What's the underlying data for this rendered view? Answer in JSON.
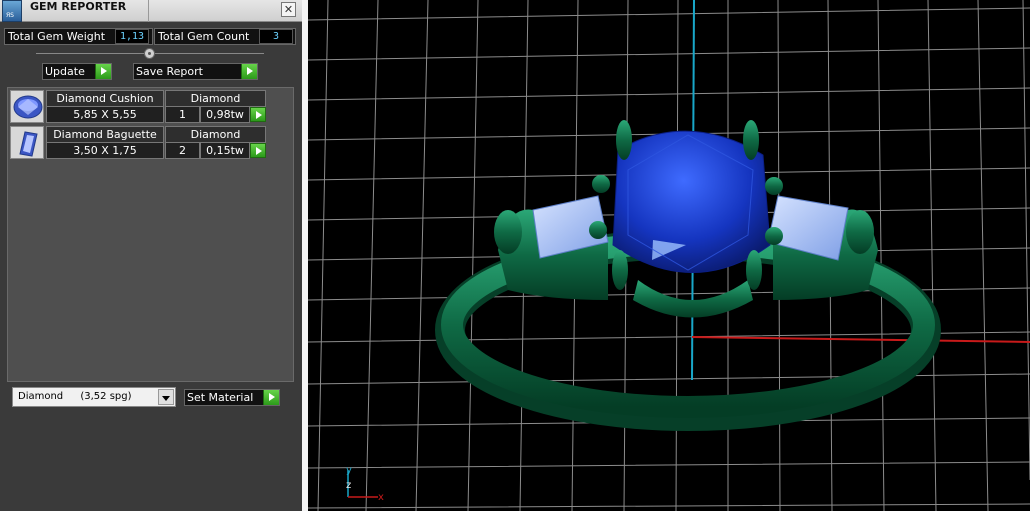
{
  "panel": {
    "title": "GEM REPORTER",
    "app_icon_text": "ЯS",
    "close_glyph": "✕",
    "stats": {
      "weight_label": "Total Gem Weight",
      "weight_value": "1,13",
      "count_label": "Total Gem Count",
      "count_value": "3"
    },
    "buttons": {
      "update": "Update",
      "save_report": "Save Report",
      "set_material": "Set Material"
    },
    "gems": [
      {
        "name": "Diamond Cushion",
        "material": "Diamond",
        "size": "5,85 X 5,55",
        "count": "1",
        "weight": "0,98tw",
        "icon": "cushion-gem-icon"
      },
      {
        "name": "Diamond Baguette",
        "material": "Diamond",
        "size": "3,50 X 1,75",
        "count": "2",
        "weight": "0,15tw",
        "icon": "baguette-gem-icon"
      }
    ],
    "material_select": {
      "name": "Diamond",
      "density": "(3,52 spg)"
    }
  },
  "viewport": {
    "axis_labels": {
      "y": "y",
      "z": "z",
      "x": "x"
    },
    "colors": {
      "grid": "#c8c8c8",
      "axis_y": "#19a7c9",
      "axis_x": "#c81a1a",
      "metal": "#0f6a45",
      "gem": "#1535c0",
      "baguette": "#a8c4ff"
    }
  }
}
